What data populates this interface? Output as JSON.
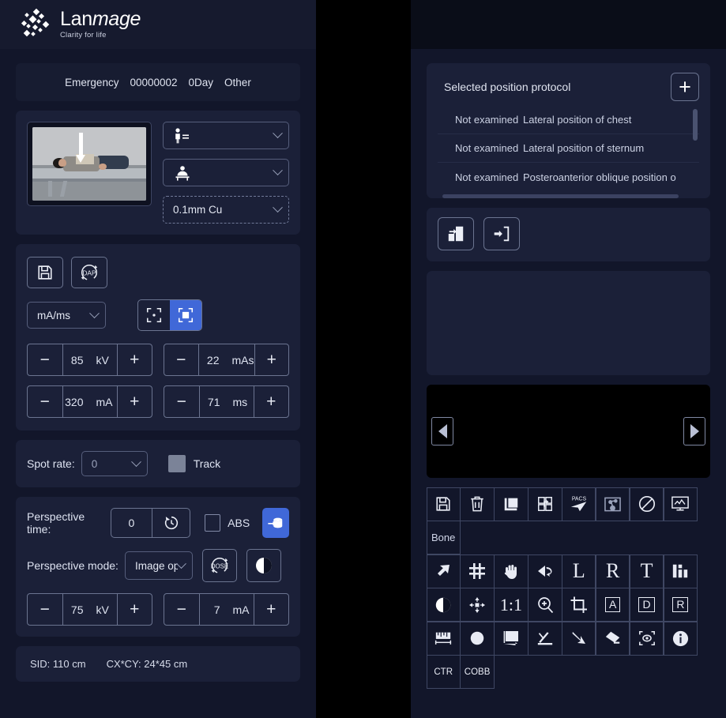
{
  "brand": {
    "name_part1": "Lan",
    "name_part2": "mage",
    "tagline": "Clarity for life"
  },
  "patient_bar": {
    "type": "Emergency",
    "id": "00000002",
    "age": "0Day",
    "other": "Other"
  },
  "acquisition": {
    "position_select": {
      "icon": "patient-standing-icon",
      "value": ""
    },
    "detector_select": {
      "icon": "patient-table-icon",
      "value": ""
    },
    "filter_select": {
      "value": "0.1mm Cu"
    }
  },
  "exposure": {
    "save_button": "save-icon",
    "dap_button": "DAP",
    "unit_mode": "mA/ms",
    "focus_small": "small-focus-icon",
    "focus_large": "large-focus-icon",
    "focus_active": "large",
    "params": [
      {
        "name": "kv",
        "value": "85",
        "unit": "kV"
      },
      {
        "name": "mas",
        "value": "22",
        "unit": "mAs"
      },
      {
        "name": "ma",
        "value": "320",
        "unit": "mA"
      },
      {
        "name": "ms",
        "value": "71",
        "unit": "ms"
      }
    ],
    "minus": "−",
    "plus": "+"
  },
  "spot": {
    "label": "Spot rate:",
    "value": "0",
    "track_label": "Track",
    "track_checked": true
  },
  "perspective": {
    "time_label": "Perspective time:",
    "time_value": "0",
    "reset_icon": "clock-reset-icon",
    "abs_label": "ABS",
    "abs_checked": false,
    "dose_save_icon": "dose-save-icon",
    "mode_label": "Perspective mode:",
    "mode_value": "Image op",
    "dose_icon": "DOSE",
    "contrast_icon": "contrast-icon",
    "params": [
      {
        "name": "kv",
        "value": "75",
        "unit": "kV"
      },
      {
        "name": "ma",
        "value": "7",
        "unit": "mA"
      }
    ]
  },
  "geometry": {
    "sid": "SID: 110 cm",
    "field": "CX*CY: 24*45 cm"
  },
  "protocol": {
    "title": "Selected position protocol",
    "add_button": "+",
    "columns": [
      "status",
      "name"
    ],
    "rows": [
      {
        "status": "Not examined",
        "name": "Lateral position of chest"
      },
      {
        "status": "Not examined",
        "name": "Lateral position of sternum"
      },
      {
        "status": "Not examined",
        "name": "Posteroanterior oblique position o"
      }
    ]
  },
  "protocol_actions": [
    {
      "name": "export-protocol",
      "icon": "export-icon"
    },
    {
      "name": "import-protocol",
      "icon": "import-icon"
    }
  ],
  "preview": {
    "prev": "previous-image-arrow",
    "next": "next-image-arrow"
  },
  "toolbar": {
    "row1": [
      {
        "name": "save-image",
        "icon": "floppy-save-icon"
      },
      {
        "name": "delete-image",
        "icon": "trash-icon"
      },
      {
        "name": "copy-image",
        "icon": "copy-icon"
      },
      {
        "name": "stitch-image",
        "icon": "stitch-icon"
      },
      {
        "name": "send-pacs",
        "icon": "pacs-send-icon",
        "label": "PACS"
      },
      {
        "name": "share-image",
        "icon": "share-node-icon"
      },
      {
        "name": "reject-image",
        "icon": "prohibit-icon"
      },
      {
        "name": "screen-output",
        "icon": "monitor-icon"
      }
    ],
    "row2": [
      {
        "name": "bone-preset",
        "label": "Bone"
      }
    ],
    "row3": [
      {
        "name": "pointer-tool",
        "icon": "arrow-pointer-icon"
      },
      {
        "name": "grid-tool",
        "icon": "grid-icon"
      },
      {
        "name": "pan-tool",
        "icon": "hand-icon"
      },
      {
        "name": "flip-tool",
        "icon": "flip-icon"
      },
      {
        "name": "mark-left",
        "label": "L"
      },
      {
        "name": "mark-right",
        "label": "R"
      },
      {
        "name": "text-tool",
        "label": "T"
      },
      {
        "name": "histogram-tool",
        "icon": "histogram-icon"
      }
    ],
    "row4": [
      {
        "name": "window-level-tool",
        "icon": "contrast-circle-icon"
      },
      {
        "name": "move-tool",
        "icon": "move-arrows-icon"
      },
      {
        "name": "actual-size-tool",
        "label": "1:1"
      },
      {
        "name": "zoom-tool",
        "icon": "zoom-in-icon"
      },
      {
        "name": "crop-tool",
        "icon": "crop-icon"
      },
      {
        "name": "mark-a",
        "label": "A"
      },
      {
        "name": "mark-d",
        "label": "D"
      },
      {
        "name": "mark-r",
        "label": "R"
      }
    ],
    "row5": [
      {
        "name": "ruler-tool",
        "icon": "ruler-icon"
      },
      {
        "name": "ellipse-tool",
        "icon": "filled-circle-icon"
      },
      {
        "name": "rect-measure-tool",
        "icon": "rect-measure-icon"
      },
      {
        "name": "angle-tool",
        "icon": "angle-icon"
      },
      {
        "name": "arrow-tool",
        "icon": "bent-arrow-icon"
      },
      {
        "name": "eraser-tool",
        "icon": "eraser-icon"
      },
      {
        "name": "magnifier-tool",
        "icon": "eye-focus-icon"
      },
      {
        "name": "info-tool",
        "icon": "info-icon"
      }
    ],
    "row6": [
      {
        "name": "ctr-tool",
        "label": "CTR"
      },
      {
        "name": "cobb-tool",
        "label": "COBB"
      }
    ]
  },
  "colors": {
    "accent": "#4068d8",
    "panel": "#1b2038",
    "app_bg": "#12162a",
    "header": "#161a2e",
    "border": "#6b7490"
  }
}
